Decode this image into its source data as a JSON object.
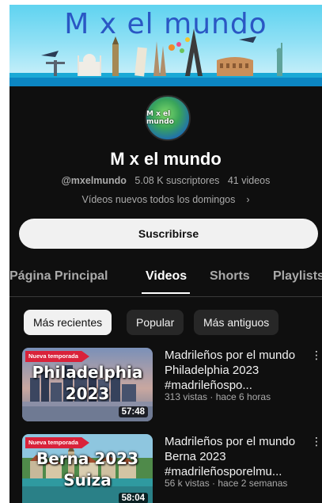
{
  "banner": {
    "title": "M x el mundo"
  },
  "channel": {
    "avatar_text": "M x el mundo",
    "name": "M x el mundo",
    "handle": "@mxelmundo",
    "subscribers": "5.08 K suscriptores",
    "videos": "41 videos",
    "description": "Vídeos nuevos todos los domingos",
    "chevron": "›"
  },
  "subscribe_label": "Suscribirse",
  "tabs": [
    {
      "label": "Página Principal",
      "active": false
    },
    {
      "label": "Videos",
      "active": true
    },
    {
      "label": "Shorts",
      "active": false
    },
    {
      "label": "Playlists",
      "active": false
    }
  ],
  "chips": [
    {
      "label": "Más recientes",
      "active": true
    },
    {
      "label": "Popular",
      "active": false
    },
    {
      "label": "Más antiguos",
      "active": false
    }
  ],
  "videos": [
    {
      "badge": "Nueva temporada",
      "thumb_line1": "Philadelphia",
      "thumb_line2": "2023",
      "duration": "57:48",
      "title": "Madrileños por el mundo Philadelphia 2023 #madrileñospo...",
      "meta": "313 vistas · hace 6 horas"
    },
    {
      "badge": "Nueva temporada",
      "thumb_line1": "Berna 2023",
      "thumb_line2": "Suiza",
      "duration": "58:04",
      "title": "Madrileños por el mundo Berna 2023 #madrileñosporelmu...",
      "meta": "56 k vistas · hace 2 semanas"
    }
  ],
  "icons": {
    "more": "more-vertical-icon",
    "chevron": "chevron-right-icon"
  },
  "colors": {
    "background": "#0f0f0f",
    "badge_red": "#d9223a",
    "banner_title": "#2a57c4",
    "secondary_text": "#aaaaaa"
  }
}
